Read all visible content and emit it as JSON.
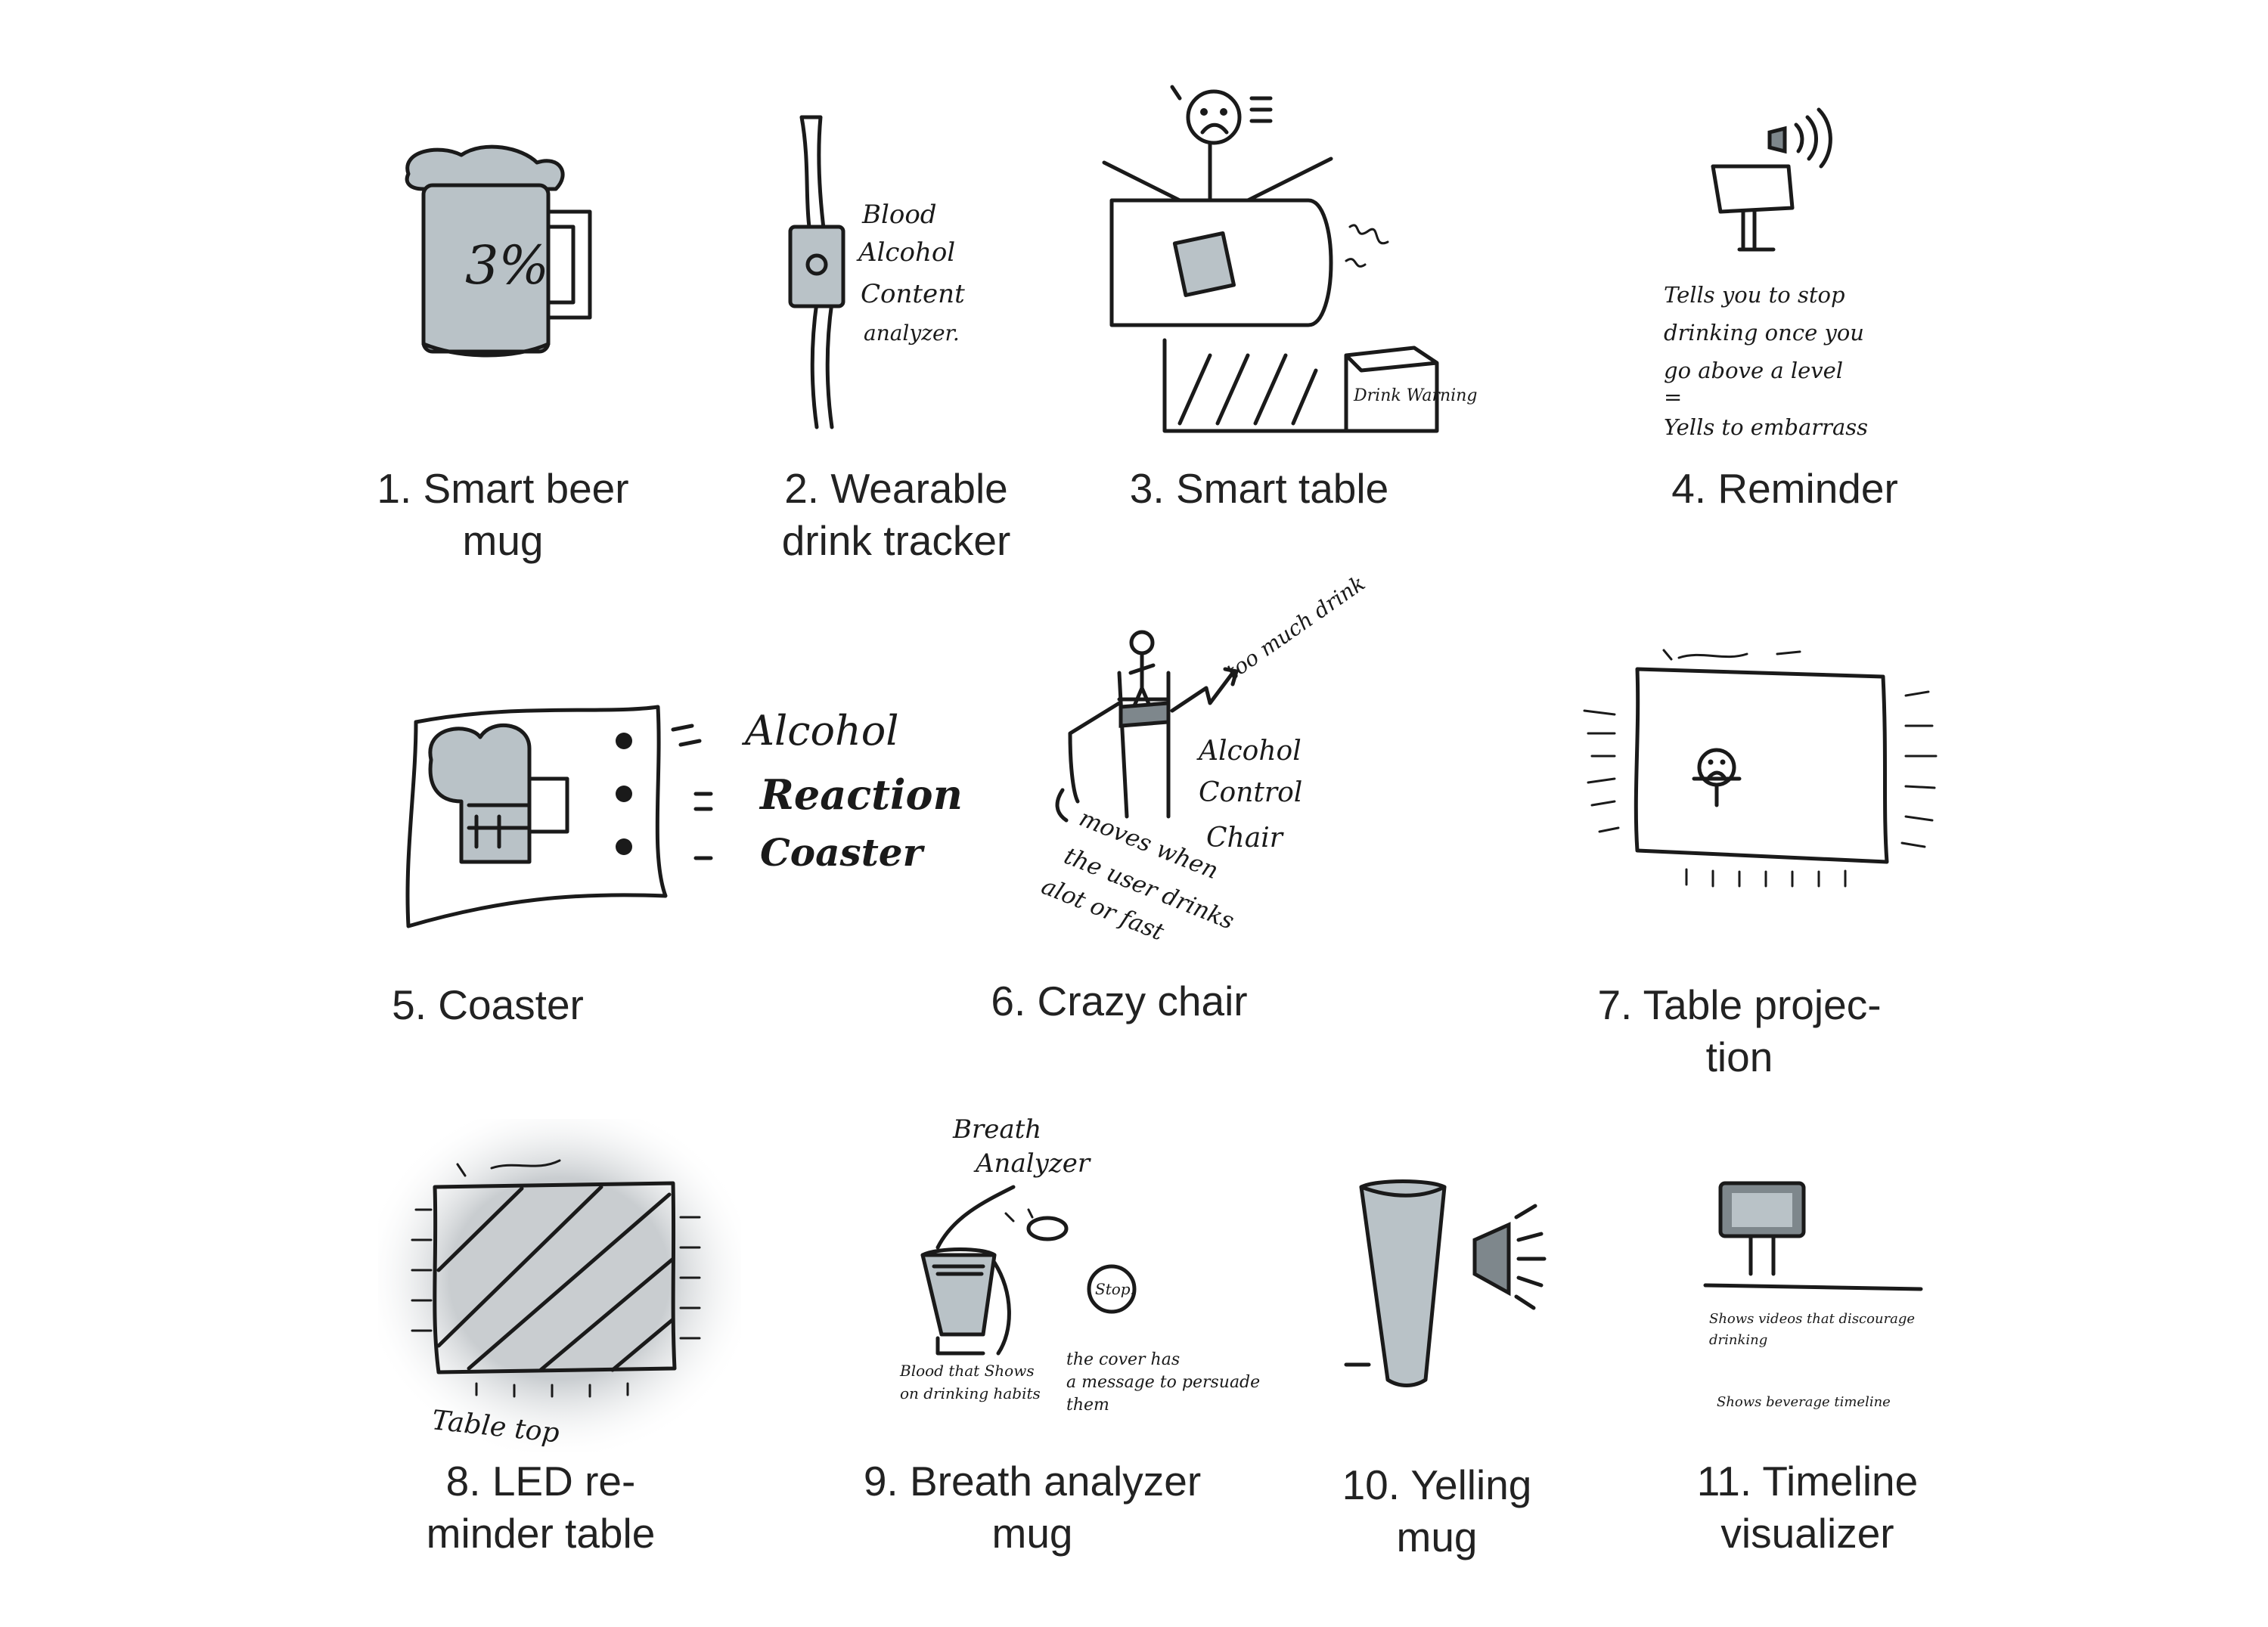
{
  "figure": {
    "captions": [
      {
        "id": 1,
        "lines": [
          "1. Smart beer",
          "mug"
        ]
      },
      {
        "id": 2,
        "lines": [
          "2. Wearable",
          "drink tracker"
        ]
      },
      {
        "id": 3,
        "lines": [
          "3. Smart table"
        ]
      },
      {
        "id": 4,
        "lines": [
          "4. Reminder"
        ]
      },
      {
        "id": 5,
        "lines": [
          "5. Coaster"
        ]
      },
      {
        "id": 6,
        "lines": [
          "6. Crazy chair"
        ]
      },
      {
        "id": 7,
        "lines": [
          "7. Table projec-",
          "tion"
        ]
      },
      {
        "id": 8,
        "lines": [
          "8. LED re-",
          "minder table"
        ]
      },
      {
        "id": 9,
        "lines": [
          "9. Breath analyzer",
          "mug"
        ]
      },
      {
        "id": 10,
        "lines": [
          "10. Yelling",
          "mug"
        ]
      },
      {
        "id": 11,
        "lines": [
          "11. Timeline",
          "visualizer"
        ]
      }
    ],
    "handwriting": {
      "mug_level": "3%",
      "tracker": [
        "Blood",
        "Alcohol",
        "Content",
        "analyzer."
      ],
      "table_box": "Drink Warning",
      "reminder": [
        "Tells you to stop",
        "drinking once you",
        "go above a level",
        "=",
        "Yells to embarrass"
      ],
      "coaster": [
        "Alcohol",
        "Reaction",
        "Coaster"
      ],
      "chair": [
        "too much drink",
        "Alcohol",
        "Control",
        "Chair",
        "moves when",
        "the user drinks",
        "alot or fast"
      ],
      "led_table": "Table top",
      "breath": [
        "Breath",
        "Analyzer",
        "Stop!",
        "Blood that Shows",
        "on drinking habits",
        "the cover has",
        "a message to persuade",
        "them"
      ],
      "timeline": [
        "Shows videos that discourage",
        "drinking",
        "Shows beverage timeline"
      ]
    },
    "colors": {
      "ink": "#1a1a1a",
      "fill": "#b9c2c7",
      "glow": "#c9cdd0"
    }
  }
}
